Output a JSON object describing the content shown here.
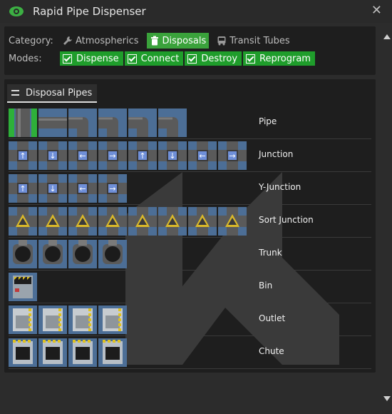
{
  "window": {
    "title": "Rapid Pipe Dispenser",
    "icon": "eye-icon",
    "close_glyph": "✕"
  },
  "filters": {
    "category_label": "Category:",
    "categories": [
      {
        "label": "Atmospherics",
        "icon": "wrench-icon",
        "selected": false
      },
      {
        "label": "Disposals",
        "icon": "trash-icon",
        "selected": true
      },
      {
        "label": "Transit Tubes",
        "icon": "bus-icon",
        "selected": false
      }
    ],
    "modes_label": "Modes:",
    "modes": [
      {
        "label": "Dispense",
        "checked": true
      },
      {
        "label": "Connect",
        "checked": true
      },
      {
        "label": "Destroy",
        "checked": true
      },
      {
        "label": "Reprogram",
        "checked": true
      }
    ]
  },
  "section": {
    "tab_label": "Disposal Pipes",
    "items": [
      {
        "name": "Pipe",
        "variants": 6
      },
      {
        "name": "Junction",
        "variants": 8
      },
      {
        "name": "Y-Junction",
        "variants": 4
      },
      {
        "name": "Sort Junction",
        "variants": 8
      },
      {
        "name": "Trunk",
        "variants": 4
      },
      {
        "name": "Bin",
        "variants": 1
      },
      {
        "name": "Outlet",
        "variants": 4
      },
      {
        "name": "Chute",
        "variants": 4
      }
    ]
  },
  "colors": {
    "accent": "#1f9d2b",
    "selected_category": "#3aa23b",
    "tile_bg": "#4c6e96"
  }
}
